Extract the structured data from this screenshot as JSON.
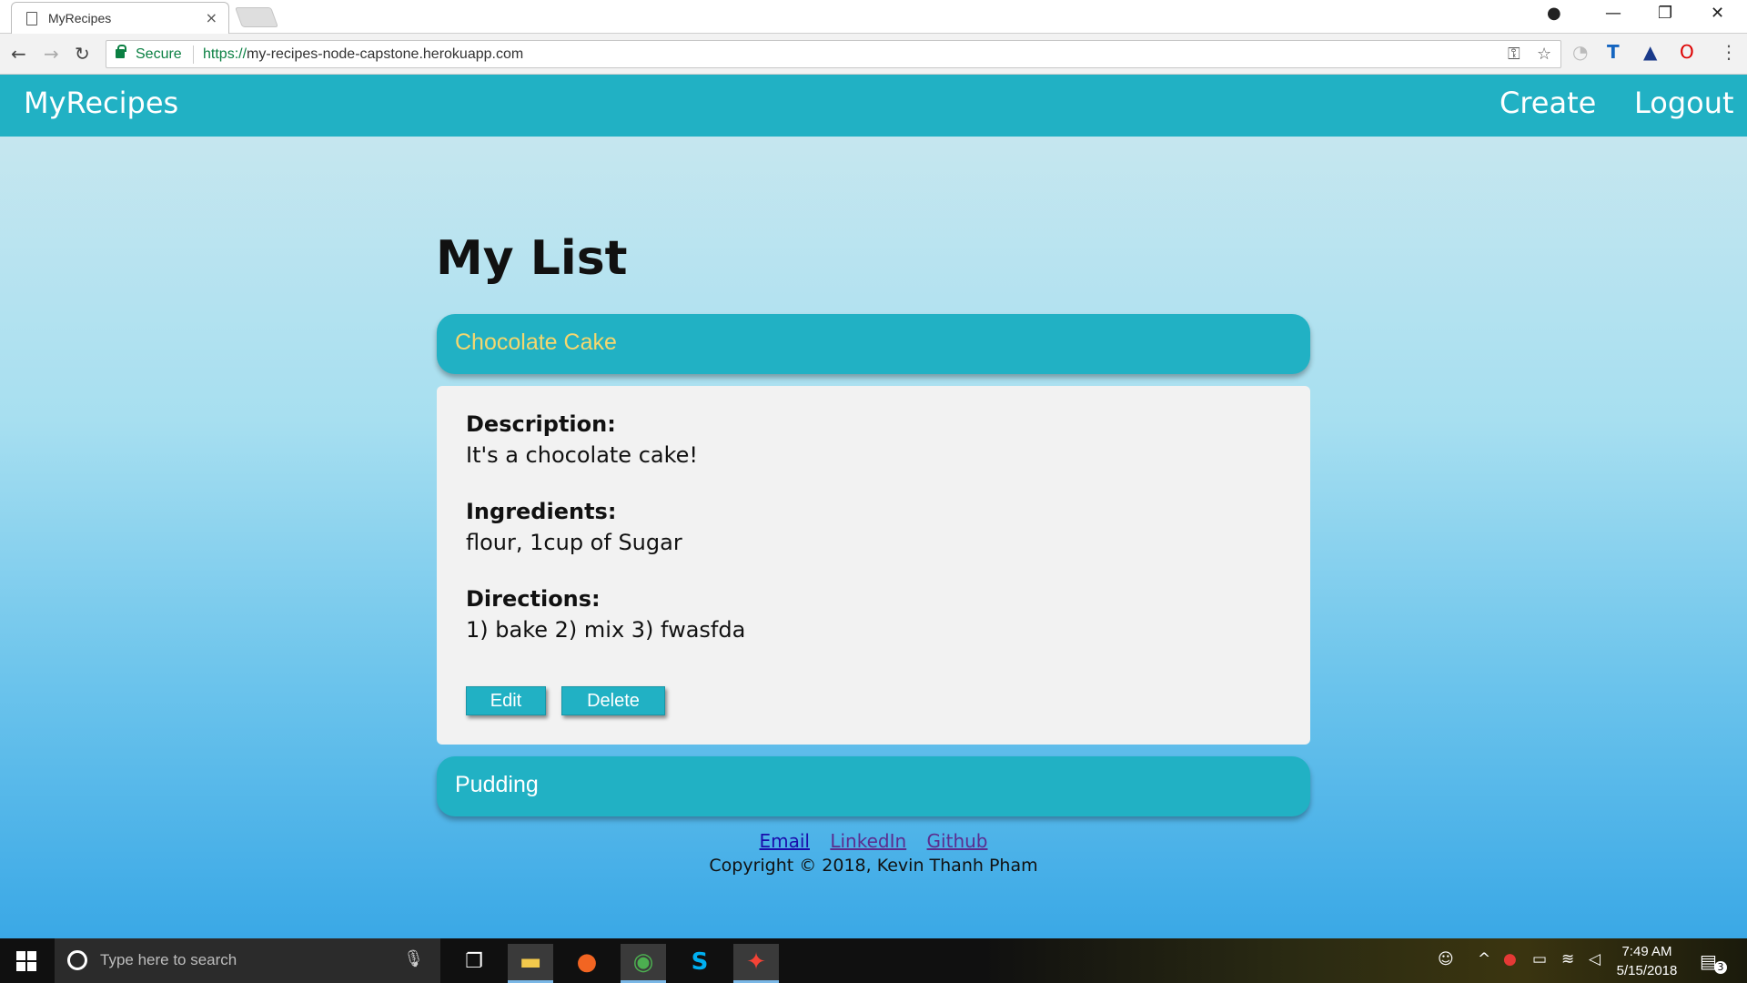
{
  "browser": {
    "tab_title": "MyRecipes",
    "tab_close": "×",
    "secure_label": "Secure",
    "url_scheme": "https://",
    "url_host": "my-recipes-node-capstone.herokuapp.com"
  },
  "navbar": {
    "brand": "MyRecipes",
    "create": "Create",
    "logout": "Logout"
  },
  "main": {
    "heading": "My List",
    "recipes": [
      {
        "name": "Chocolate Cake",
        "description_label": "Description:",
        "description": "It's a chocolate cake!",
        "ingredients_label": "Ingredients:",
        "ingredients": "flour, 1cup of Sugar",
        "directions_label": "Directions:",
        "directions": "1) bake 2) mix 3) fwasfda",
        "edit_label": "Edit",
        "delete_label": "Delete"
      },
      {
        "name": "Pudding"
      }
    ]
  },
  "footer": {
    "email": "Email",
    "linkedin": "LinkedIn",
    "github": "Github",
    "copyright": "Copyright © 2018, Kevin Thanh Pham"
  },
  "taskbar": {
    "search_placeholder": "Type here to search",
    "time": "7:49 AM",
    "date": "5/15/2018",
    "notification_count": "3"
  },
  "colors": {
    "accent": "#21b1c4",
    "active_recipe_title": "#f5d76e"
  }
}
